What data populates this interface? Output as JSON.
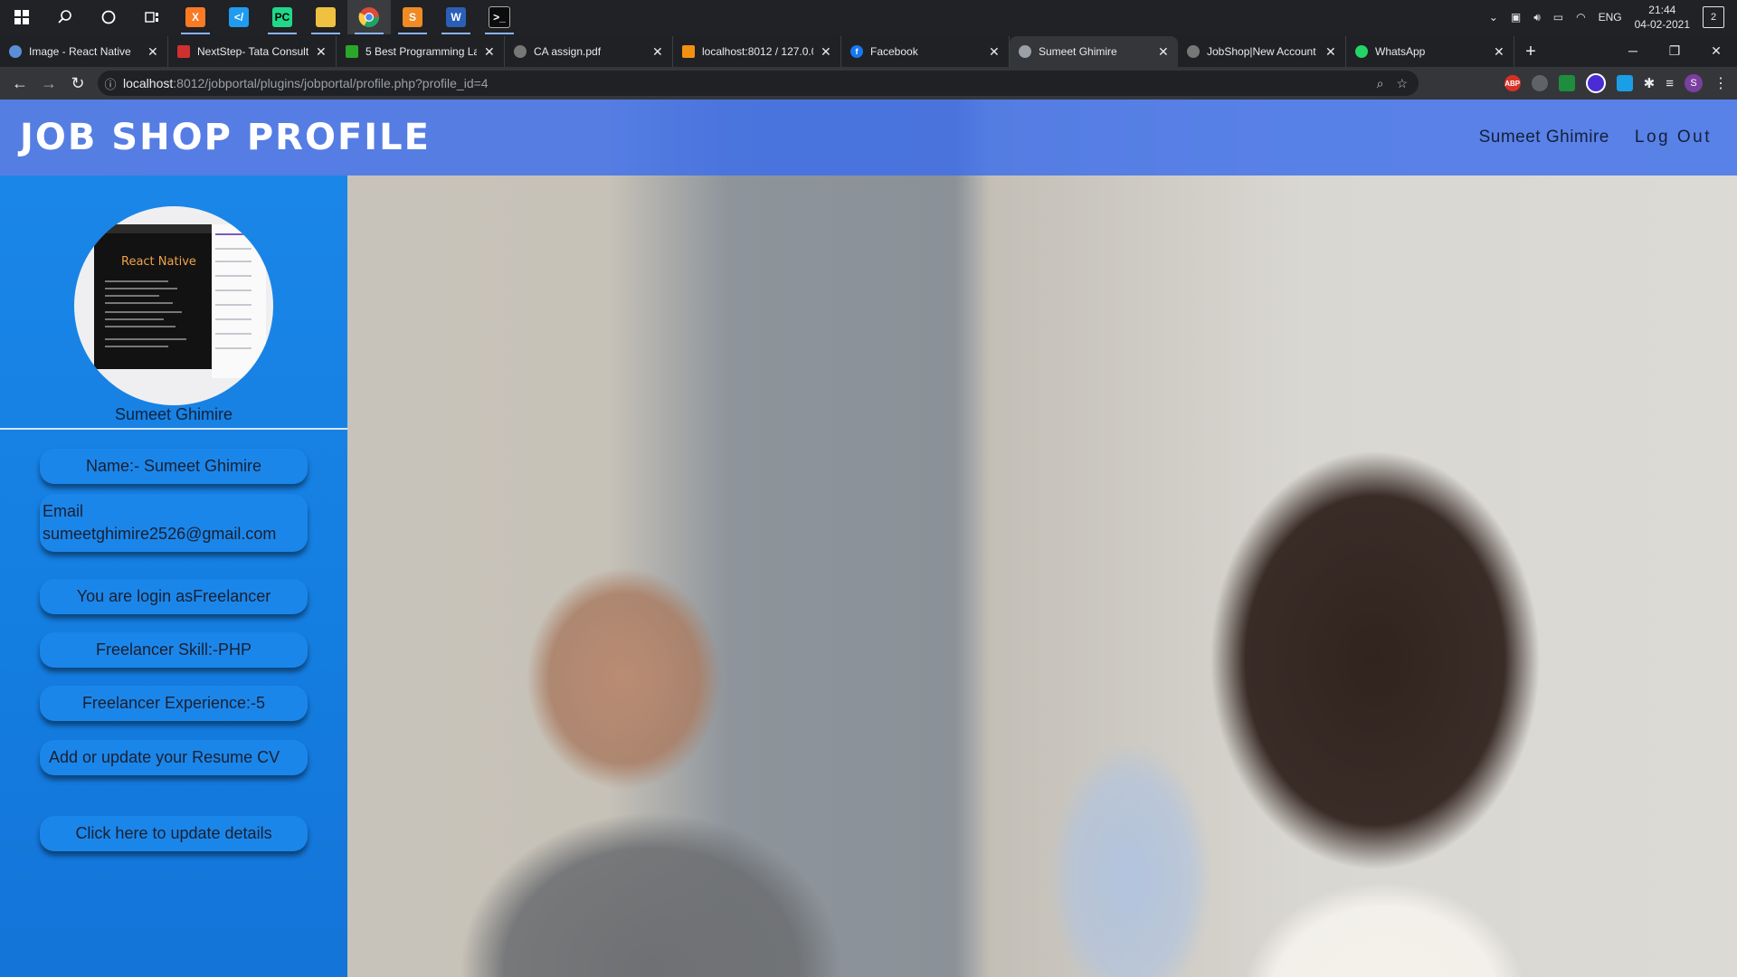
{
  "taskbar": {
    "apps": [
      {
        "name": "xampp",
        "color": "#fb7a24",
        "glyph": "X"
      },
      {
        "name": "vscode",
        "color": "#1f9cf0",
        "glyph": "&lt;"
      },
      {
        "name": "pycharm",
        "color": "#21d789",
        "glyph": "PC"
      },
      {
        "name": "file-explorer",
        "color": "#f0c040",
        "glyph": ""
      },
      {
        "name": "chrome",
        "color": "#dd4b39",
        "glyph": ""
      },
      {
        "name": "sublime",
        "color": "#f08a24",
        "glyph": "S"
      },
      {
        "name": "word",
        "color": "#2b5fb7",
        "glyph": "W"
      },
      {
        "name": "terminal",
        "color": "#444",
        "glyph": ""
      }
    ],
    "language": "ENG",
    "time": "21:44",
    "date": "04-02-2021",
    "notifications": "2"
  },
  "browser": {
    "tabs": [
      {
        "title": "Image - React Native",
        "fav_color": "#5a8fd8"
      },
      {
        "title": "NextStep- Tata Consult",
        "fav_color": "#d0302f"
      },
      {
        "title": "5 Best Programming La",
        "fav_color": "#2aa62a"
      },
      {
        "title": "CA assign.pdf",
        "fav_color": "#777"
      },
      {
        "title": "localhost:8012 / 127.0.0",
        "fav_color": "#f29111"
      },
      {
        "title": "Facebook",
        "fav_color": "#1877f2"
      },
      {
        "title": "Sumeet Ghimire",
        "fav_color": "#9aa0a6"
      },
      {
        "title": "JobShop|New Account",
        "fav_color": "#777"
      },
      {
        "title": "WhatsApp",
        "fav_color": "#25d366"
      }
    ],
    "active_tab_index": 6,
    "url_host": "localhost",
    "url_path": ":8012/jobportal/plugins/jobportal/profile.php?profile_id=4",
    "profile_initial": "S",
    "extensions": [
      {
        "name": "adblock-icon",
        "color": "#d93025",
        "glyph": "ABP"
      },
      {
        "name": "extension-gray-icon",
        "color": "#5f6368",
        "glyph": ""
      },
      {
        "name": "shield-extension-icon",
        "color": "#1e8e3e",
        "glyph": ""
      },
      {
        "name": "purple-extension-icon",
        "color": "#4b2bd6",
        "glyph": ""
      },
      {
        "name": "translate-extension-icon",
        "color": "#1a9ee8",
        "glyph": ""
      }
    ]
  },
  "site": {
    "brand": "JOB SHOP PROFILE",
    "nav": {
      "user": "Sumeet Ghimire",
      "logout": "Log Out"
    },
    "profile": {
      "name": "Sumeet Ghimire",
      "photo_caption": "React Native",
      "fields": [
        {
          "text": "Name:- Sumeet Ghimire"
        },
        {
          "text": "Email sumeetghimire2526@gmail.com"
        },
        {
          "text": "You are login asFreelancer"
        },
        {
          "text": "Freelancer Skill:-PHP"
        },
        {
          "text": "Freelancer Experience:-5"
        },
        {
          "text": "Add or update your Resume CV"
        },
        {
          "text": "Click here to update details"
        }
      ]
    }
  },
  "colors": {
    "header": "#3c6eeb",
    "sidebar": "#1a86e8",
    "pill": "#1b86ea"
  }
}
